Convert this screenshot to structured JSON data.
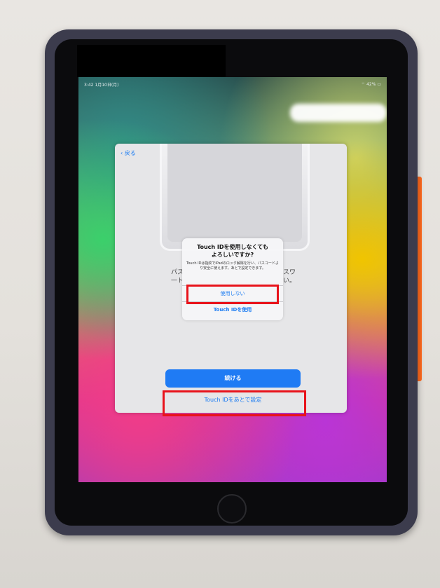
{
  "status_bar": {
    "time": "3:42  1月10日(月)",
    "right": "⌔ 42% ▭"
  },
  "setup": {
    "back_label": "‹ 戻る",
    "bg_text_left": "パス\n一ト",
    "bg_text_right": "スワ\nい。",
    "primary_button": "続ける",
    "secondary_link": "Touch IDをあとで設定"
  },
  "alert": {
    "title": "Touch IDを使用しなくても\nよろしいですか?",
    "message": "Touch IDは指紋でiPadのロック解除を行い、パスコードより安全に使えます。あとで設定できます。",
    "button_1": "使用しない",
    "button_2": "Touch IDを使用"
  }
}
